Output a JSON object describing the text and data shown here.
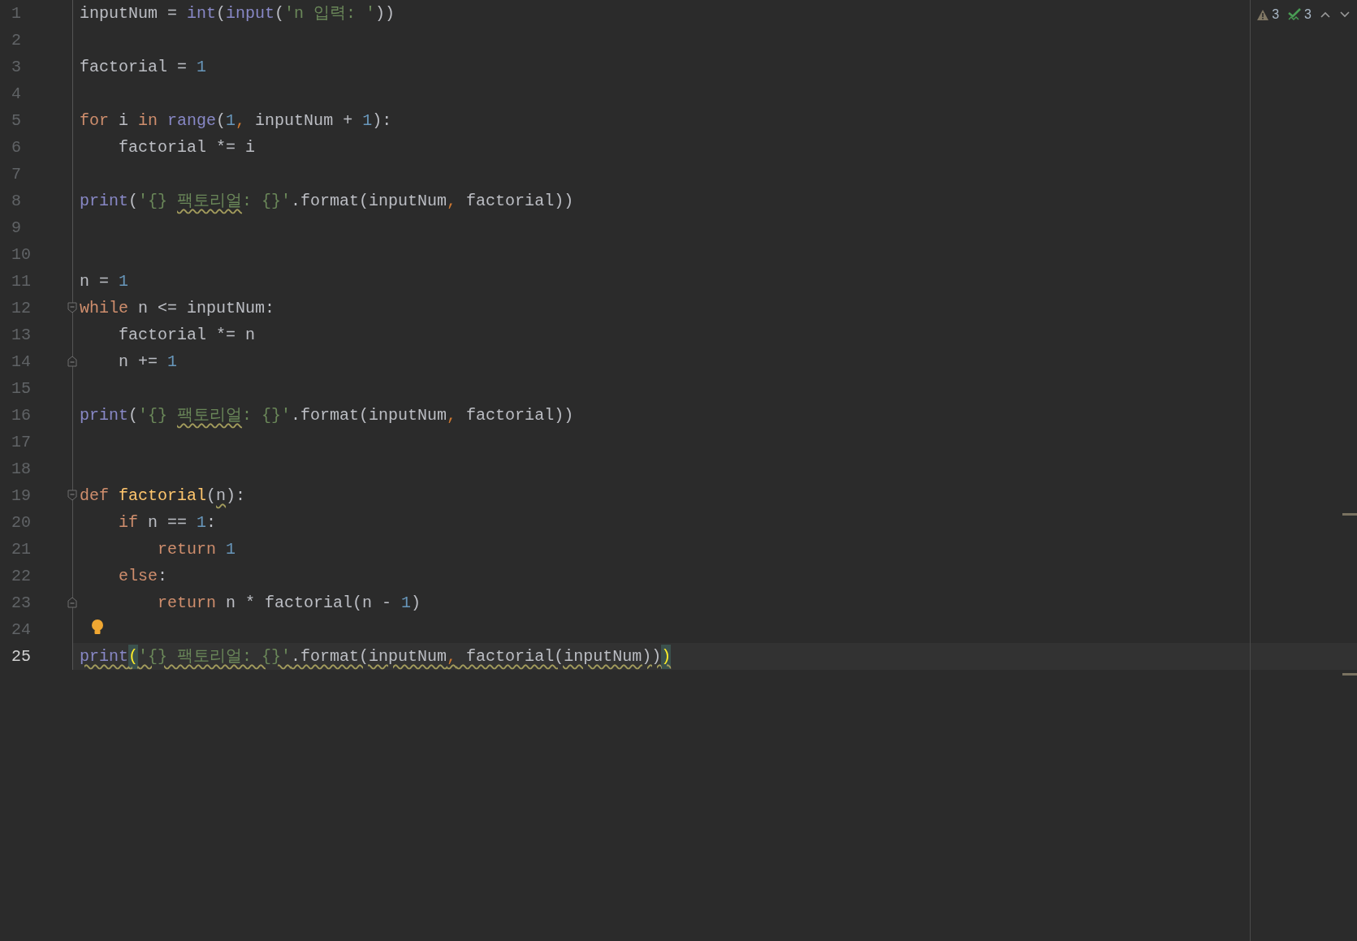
{
  "inspections": {
    "warnings": "3",
    "weak_warnings": "3"
  },
  "lines": [
    {
      "number": "1",
      "tokens": [
        {
          "kind": "plain",
          "text": "inputNum = "
        },
        {
          "kind": "builtin",
          "text": "int"
        },
        {
          "kind": "plain",
          "text": "("
        },
        {
          "kind": "builtin",
          "text": "input"
        },
        {
          "kind": "plain",
          "text": "("
        },
        {
          "kind": "string",
          "text": "'n 입력: '"
        },
        {
          "kind": "plain",
          "text": "))"
        }
      ]
    },
    {
      "number": "2"
    },
    {
      "number": "3",
      "tokens": [
        {
          "kind": "plain",
          "text": "factorial = "
        },
        {
          "kind": "number",
          "text": "1"
        }
      ]
    },
    {
      "number": "4"
    },
    {
      "number": "5",
      "tokens": [
        {
          "kind": "keyword",
          "text": "for"
        },
        {
          "kind": "plain",
          "text": " i "
        },
        {
          "kind": "keyword",
          "text": "in"
        },
        {
          "kind": "builtin",
          "text": " range"
        },
        {
          "kind": "plain",
          "text": "("
        },
        {
          "kind": "number",
          "text": "1"
        },
        {
          "kind": "comma",
          "text": ","
        },
        {
          "kind": "plain",
          "text": " inputNum + "
        },
        {
          "kind": "number",
          "text": "1"
        },
        {
          "kind": "plain",
          "text": "):"
        }
      ]
    },
    {
      "number": "6",
      "tokens": [
        {
          "kind": "plain",
          "text": "    factorial *= i"
        }
      ]
    },
    {
      "number": "7"
    },
    {
      "number": "8",
      "tokens": [
        {
          "kind": "builtin",
          "text": "print"
        },
        {
          "kind": "plain",
          "text": "("
        },
        {
          "kind": "string",
          "text": "'{} "
        },
        {
          "kind": "string",
          "text": "팩토리얼",
          "warn": true
        },
        {
          "kind": "string",
          "text": ": {}'"
        },
        {
          "kind": "plain",
          "text": ".format(inputNum"
        },
        {
          "kind": "comma",
          "text": ","
        },
        {
          "kind": "plain",
          "text": " factorial))"
        }
      ]
    },
    {
      "number": "9"
    },
    {
      "number": "10"
    },
    {
      "number": "11",
      "tokens": [
        {
          "kind": "plain",
          "text": "n = "
        },
        {
          "kind": "number",
          "text": "1"
        }
      ]
    },
    {
      "number": "12",
      "fold_open": true,
      "tokens": [
        {
          "kind": "keyword",
          "text": "while"
        },
        {
          "kind": "plain",
          "text": " n <= inputNum:"
        }
      ]
    },
    {
      "number": "13",
      "tokens": [
        {
          "kind": "plain",
          "text": "    factorial *= n"
        }
      ]
    },
    {
      "number": "14",
      "fold_close": true,
      "tokens": [
        {
          "kind": "plain",
          "text": "    n += "
        },
        {
          "kind": "number",
          "text": "1"
        }
      ]
    },
    {
      "number": "15"
    },
    {
      "number": "16",
      "tokens": [
        {
          "kind": "builtin",
          "text": "print"
        },
        {
          "kind": "plain",
          "text": "("
        },
        {
          "kind": "string",
          "text": "'{} "
        },
        {
          "kind": "string",
          "text": "팩토리얼",
          "warn": true
        },
        {
          "kind": "string",
          "text": ": {}'"
        },
        {
          "kind": "plain",
          "text": ".format(inputNum"
        },
        {
          "kind": "comma",
          "text": ","
        },
        {
          "kind": "plain",
          "text": " factorial))"
        }
      ]
    },
    {
      "number": "17"
    },
    {
      "number": "18"
    },
    {
      "number": "19",
      "fold_open": true,
      "tokens": [
        {
          "kind": "keyword",
          "text": "def"
        },
        {
          "kind": "funcdef",
          "text": " factorial"
        },
        {
          "kind": "plain",
          "text": "("
        },
        {
          "kind": "plain",
          "text": "n",
          "warn": true
        },
        {
          "kind": "plain",
          "text": "):"
        }
      ]
    },
    {
      "number": "20",
      "tokens": [
        {
          "kind": "keyword",
          "text": "    if"
        },
        {
          "kind": "plain",
          "text": " n == "
        },
        {
          "kind": "number",
          "text": "1"
        },
        {
          "kind": "plain",
          "text": ":"
        }
      ]
    },
    {
      "number": "21",
      "tokens": [
        {
          "kind": "keyword",
          "text": "        return"
        },
        {
          "kind": "number",
          "text": " 1"
        }
      ]
    },
    {
      "number": "22",
      "tokens": [
        {
          "kind": "keyword",
          "text": "    else"
        },
        {
          "kind": "plain",
          "text": ":"
        }
      ]
    },
    {
      "number": "23",
      "fold_close": true,
      "tokens": [
        {
          "kind": "keyword",
          "text": "        return"
        },
        {
          "kind": "plain",
          "text": " n * factorial(n - "
        },
        {
          "kind": "number",
          "text": "1"
        },
        {
          "kind": "plain",
          "text": ")"
        }
      ]
    },
    {
      "number": "24",
      "bulb": true
    },
    {
      "number": "25",
      "current": true,
      "tokens": [
        {
          "kind": "builtin",
          "text": "print",
          "warn": true
        },
        {
          "kind": "brace",
          "text": "(",
          "warn": true
        },
        {
          "kind": "string",
          "text": "'{} 팩토리얼: {}'",
          "warn": true
        },
        {
          "kind": "plain",
          "text": ".format(inputNum",
          "warn": true
        },
        {
          "kind": "comma",
          "text": ",",
          "warn": true
        },
        {
          "kind": "plain",
          "text": " factorial(inputNum))",
          "warn": true
        },
        {
          "kind": "brace",
          "text": ")",
          "warn": true
        }
      ]
    }
  ]
}
